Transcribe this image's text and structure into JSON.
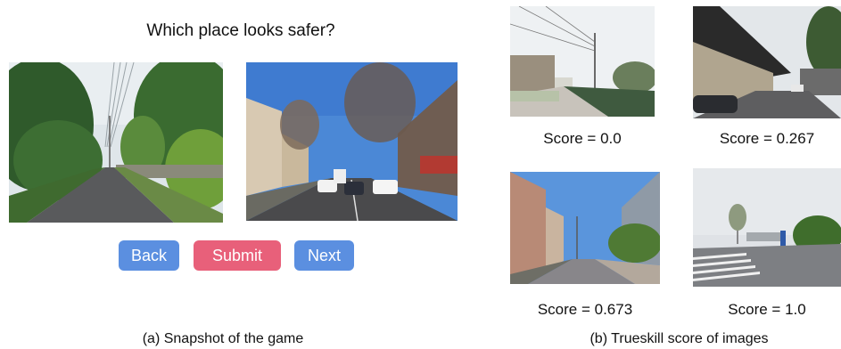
{
  "game": {
    "question": "Which place looks safer?",
    "buttons": {
      "back": "Back",
      "submit": "Submit",
      "next": "Next"
    },
    "colors": {
      "back": "#5b8fe0",
      "submit": "#e8607a",
      "next": "#5b8fe0"
    },
    "caption": "(a) Snapshot of the game"
  },
  "trueskill": {
    "scores": [
      "Score = 0.0",
      "Score = 0.267",
      "Score = 0.673",
      "Score = 1.0"
    ],
    "caption": "(b) Trueskill score of images"
  }
}
